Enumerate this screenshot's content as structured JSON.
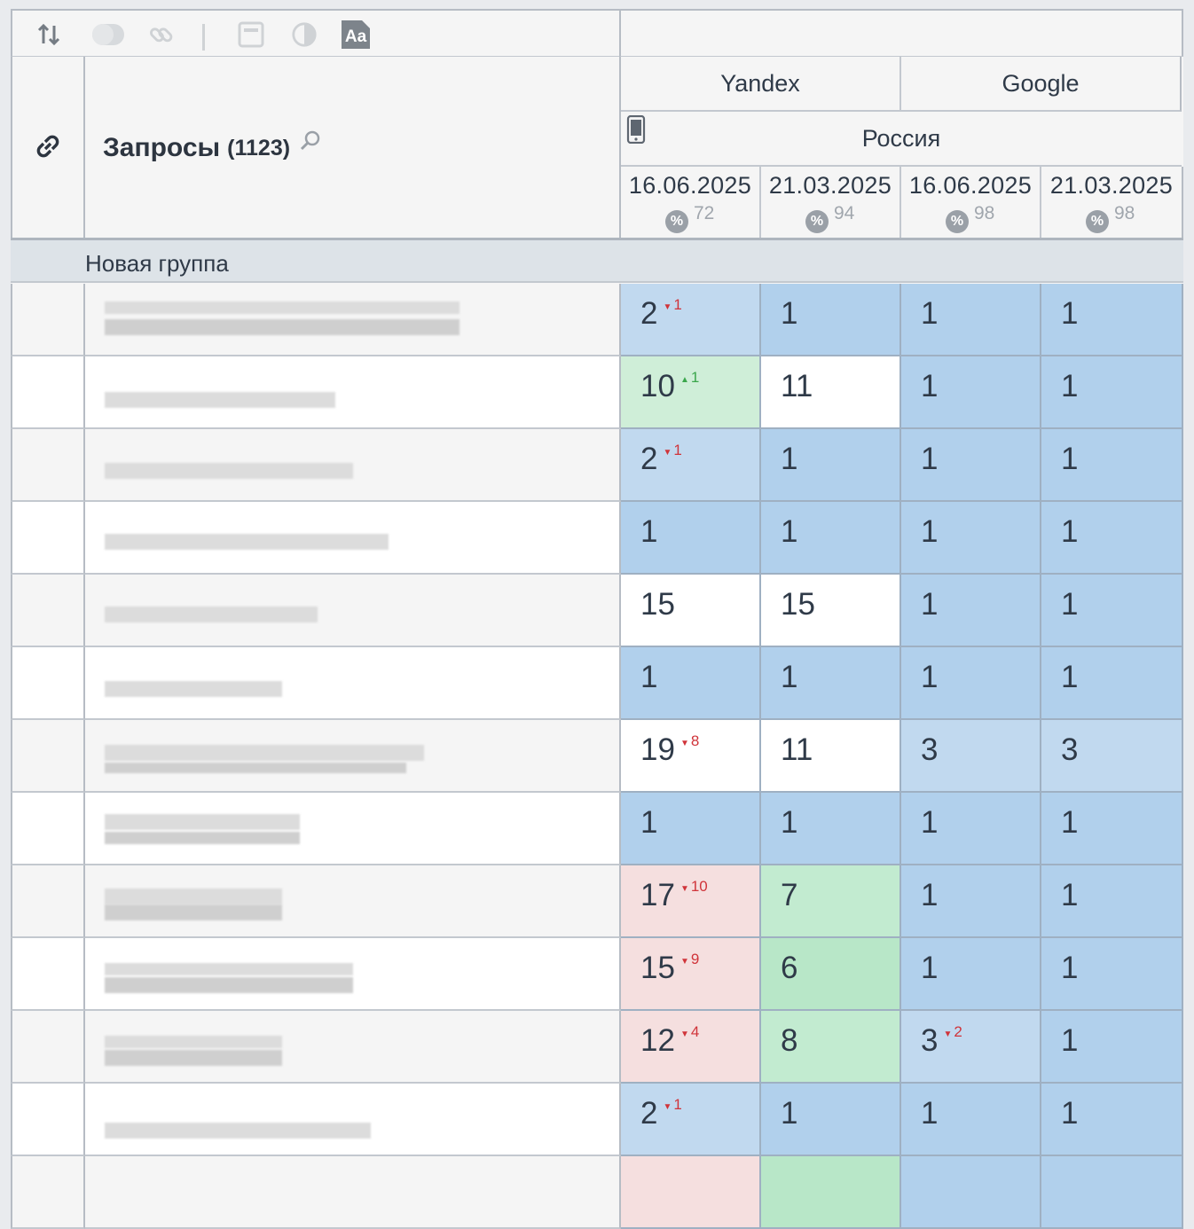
{
  "toolbar": {
    "icons": [
      "sort-icon",
      "toggle-icon",
      "link-icon",
      "window-icon",
      "contrast-icon",
      "font-icon"
    ],
    "font_icon_text": "Aa"
  },
  "header": {
    "title": "Запросы",
    "count": "(1123)",
    "engines": [
      "Yandex",
      "Google"
    ],
    "region": "Россия",
    "columns": [
      {
        "date": "16.06.2025",
        "percent": "72",
        "percent_icon": "%"
      },
      {
        "date": "21.03.2025",
        "percent": "94",
        "percent_icon": "%"
      },
      {
        "date": "16.06.2025",
        "percent": "98",
        "percent_icon": "%"
      },
      {
        "date": "21.03.2025",
        "percent": "98",
        "percent_icon": "%"
      }
    ]
  },
  "group": {
    "label": "Новая группа"
  },
  "rows": [
    {
      "cells": [
        {
          "v": "2",
          "d": "1",
          "dir": "down",
          "c": "c-light"
        },
        {
          "v": "1",
          "c": "c-blue"
        },
        {
          "v": "1",
          "c": "c-blue"
        },
        {
          "v": "1",
          "c": "c-blue"
        }
      ]
    },
    {
      "cells": [
        {
          "v": "10",
          "d": "1",
          "dir": "up",
          "c": "c-green"
        },
        {
          "v": "11",
          "c": "c-white"
        },
        {
          "v": "1",
          "c": "c-blue"
        },
        {
          "v": "1",
          "c": "c-blue"
        }
      ]
    },
    {
      "cells": [
        {
          "v": "2",
          "d": "1",
          "dir": "down",
          "c": "c-light"
        },
        {
          "v": "1",
          "c": "c-blue"
        },
        {
          "v": "1",
          "c": "c-blue"
        },
        {
          "v": "1",
          "c": "c-blue"
        }
      ]
    },
    {
      "cells": [
        {
          "v": "1",
          "c": "c-blue"
        },
        {
          "v": "1",
          "c": "c-blue"
        },
        {
          "v": "1",
          "c": "c-blue"
        },
        {
          "v": "1",
          "c": "c-blue"
        }
      ]
    },
    {
      "cells": [
        {
          "v": "15",
          "c": "c-white"
        },
        {
          "v": "15",
          "c": "c-white"
        },
        {
          "v": "1",
          "c": "c-blue"
        },
        {
          "v": "1",
          "c": "c-blue"
        }
      ]
    },
    {
      "cells": [
        {
          "v": "1",
          "c": "c-blue"
        },
        {
          "v": "1",
          "c": "c-blue"
        },
        {
          "v": "1",
          "c": "c-blue"
        },
        {
          "v": "1",
          "c": "c-blue"
        }
      ]
    },
    {
      "cells": [
        {
          "v": "19",
          "d": "8",
          "dir": "down",
          "c": "c-white"
        },
        {
          "v": "11",
          "c": "c-white"
        },
        {
          "v": "3",
          "c": "c-light"
        },
        {
          "v": "3",
          "c": "c-light"
        }
      ]
    },
    {
      "cells": [
        {
          "v": "1",
          "c": "c-blue"
        },
        {
          "v": "1",
          "c": "c-blue"
        },
        {
          "v": "1",
          "c": "c-blue"
        },
        {
          "v": "1",
          "c": "c-blue"
        }
      ]
    },
    {
      "cells": [
        {
          "v": "17",
          "d": "10",
          "dir": "down",
          "c": "c-red"
        },
        {
          "v": "7",
          "c": "c-green3"
        },
        {
          "v": "1",
          "c": "c-blue"
        },
        {
          "v": "1",
          "c": "c-blue"
        }
      ]
    },
    {
      "cells": [
        {
          "v": "15",
          "d": "9",
          "dir": "down",
          "c": "c-red"
        },
        {
          "v": "6",
          "c": "c-green2"
        },
        {
          "v": "1",
          "c": "c-blue"
        },
        {
          "v": "1",
          "c": "c-blue"
        }
      ]
    },
    {
      "cells": [
        {
          "v": "12",
          "d": "4",
          "dir": "down",
          "c": "c-red"
        },
        {
          "v": "8",
          "c": "c-green3"
        },
        {
          "v": "3",
          "d": "2",
          "dir": "down",
          "c": "c-light"
        },
        {
          "v": "1",
          "c": "c-blue"
        }
      ]
    },
    {
      "cells": [
        {
          "v": "2",
          "d": "1",
          "dir": "down",
          "c": "c-light"
        },
        {
          "v": "1",
          "c": "c-blue"
        },
        {
          "v": "1",
          "c": "c-blue"
        },
        {
          "v": "1",
          "c": "c-blue"
        }
      ]
    },
    {
      "cells": [
        {
          "v": "",
          "c": "c-red"
        },
        {
          "v": "",
          "c": "c-green2"
        },
        {
          "v": "",
          "c": "c-blue"
        },
        {
          "v": "",
          "c": "c-blue"
        }
      ]
    }
  ],
  "colors": {
    "blue": "#b1d0ec",
    "light_blue": "#c1d9ef",
    "green": "#cfeed8",
    "red": "#f5dfdf",
    "delta_down": "#d0343a",
    "delta_up": "#3aa64b"
  }
}
